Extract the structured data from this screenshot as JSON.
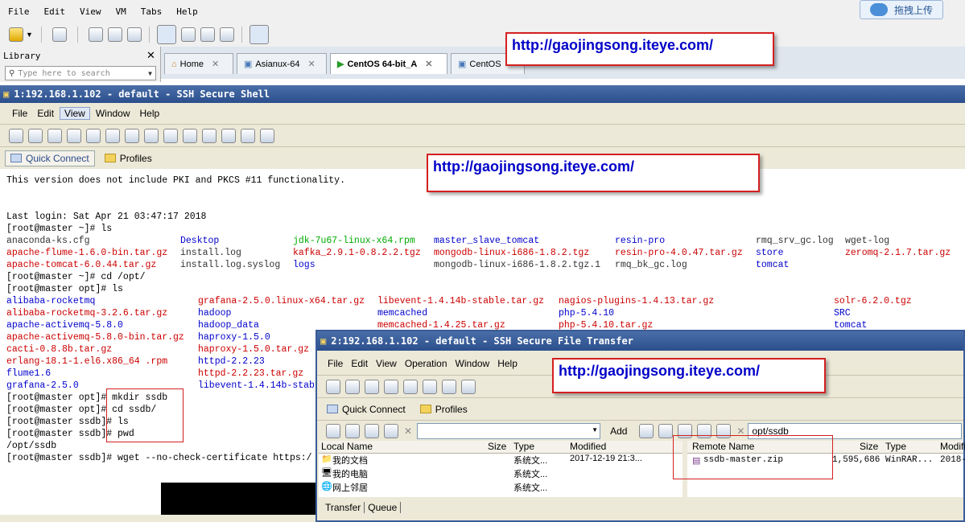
{
  "vmware": {
    "menu": [
      "File",
      "Edit",
      "View",
      "VM",
      "Tabs",
      "Help"
    ],
    "upload_label": "拖拽上传",
    "library": {
      "title": "Library",
      "search_placeholder": "Type here to search"
    },
    "tabs": [
      {
        "label": "Home",
        "active": false
      },
      {
        "label": "Asianux-64",
        "active": false
      },
      {
        "label": "CentOS 64-bit_A",
        "active": true
      },
      {
        "label": "CentOS",
        "active": false
      }
    ]
  },
  "ssh_shell": {
    "title": "1:192.168.1.102 - default - SSH Secure Shell",
    "menu": [
      "File",
      "Edit",
      "View",
      "Window",
      "Help"
    ],
    "quick_connect": "Quick Connect",
    "profiles": "Profiles",
    "terminal": {
      "banner": "This version does not include PKI and PKCS #11 functionality.",
      "last_login": "Last login: Sat Apr 21 03:47:17 2018",
      "cmd_ls": "[root@master ~]# ls",
      "home_cols": [
        [
          "anaconda-ks.cfg",
          "apache-flume-1.6.0-bin.tar.gz",
          "apache-tomcat-6.0.44.tar.gz"
        ],
        [
          "Desktop",
          "install.log",
          "install.log.syslog"
        ],
        [
          "jdk-7u67-linux-x64.rpm",
          "kafka_2.9.1-0.8.2.2.tgz",
          "logs"
        ],
        [
          "master_slave_tomcat",
          "mongodb-linux-i686-1.8.2.tgz",
          "mongodb-linux-i686-1.8.2.tgz.1"
        ],
        [
          "resin-pro",
          "resin-pro-4.0.47.tar.gz",
          "rmq_bk_gc.log"
        ],
        [
          "rmq_srv_gc.log",
          "store",
          "tomcat"
        ],
        [
          "wget-log",
          "zeromq-2.1.7.tar.gz",
          ""
        ]
      ],
      "cmd_cd_opt": "[root@master ~]# cd /opt/",
      "cmd_ls_opt": "[root@master opt]# ls",
      "opt_cols": [
        [
          "alibaba-rocketmq",
          "alibaba-rocketmq-3.2.6.tar.gz",
          "apache-activemq-5.8.0",
          "apache-activemq-5.8.0-bin.tar.gz",
          "cacti-0.8.8b.tar.gz",
          "erlang-18.1-1.el6.x86_64 .rpm",
          "flume1.6",
          "grafana-2.5.0"
        ],
        [
          "grafana-2.5.0.linux-x64.tar.gz",
          "hadoop",
          "hadoop_data",
          "haproxy-1.5.0",
          "haproxy-1.5.0.tar.gz",
          "httpd-2.2.23",
          "httpd-2.2.23.tar.gz",
          "libevent-1.4.14b-stab"
        ],
        [
          "libevent-1.4.14b-stable.tar.gz",
          "memcached",
          "memcached-1.4.25.tar.gz"
        ],
        [
          "nagios-plugins-1.4.13.tar.gz",
          "php-5.4.10",
          "php-5.4.10.tar.gz"
        ],
        [
          "solr-6.2.0.tgz",
          "SRC",
          "tomcat"
        ]
      ],
      "cmd_mkdir": "[root@master opt]# mkdir ssdb",
      "cmd_cd_ssdb": "[root@master opt]# cd ssdb/",
      "cmd_ls_ssdb": "[root@master ssdb]# ls",
      "cmd_pwd": "[root@master ssdb]# pwd",
      "pwd_out": "/opt/ssdb",
      "cmd_wget": "[root@master ssdb]# wget --no-check-certificate https:/"
    }
  },
  "sftp": {
    "title": "2:192.168.1.102 - default - SSH Secure File Transfer",
    "menu": [
      "File",
      "Edit",
      "View",
      "Operation",
      "Window",
      "Help"
    ],
    "quick_connect": "Quick Connect",
    "profiles": "Profiles",
    "add_label": "Add",
    "remote_path": "opt/ssdb",
    "local_headers": [
      "Local Name",
      "Size",
      "Type",
      "Modified"
    ],
    "local_rows": [
      {
        "name": "我的文档",
        "size": "",
        "type": "系统文...",
        "modified": "2017-12-19 21:3..."
      },
      {
        "name": "我的电脑",
        "size": "",
        "type": "系统文...",
        "modified": ""
      },
      {
        "name": "网上邻居",
        "size": "",
        "type": "系统文...",
        "modified": ""
      }
    ],
    "remote_headers": [
      "Remote Name",
      "Size",
      "Type",
      "Modifi"
    ],
    "remote_rows": [
      {
        "name": "ssdb-master.zip",
        "size": "1,595,686",
        "type": "WinRAR...",
        "modified": "2018-"
      }
    ],
    "bottom_tabs": [
      "Transfer",
      "Queue"
    ]
  },
  "annotations": {
    "url": "http://gaojingsong.iteye.com/"
  },
  "colors": {
    "link_red": "#d42020",
    "dir_blue": "#0000cc",
    "archive_red": "#cc0000",
    "exec_green": "#00aa00"
  }
}
